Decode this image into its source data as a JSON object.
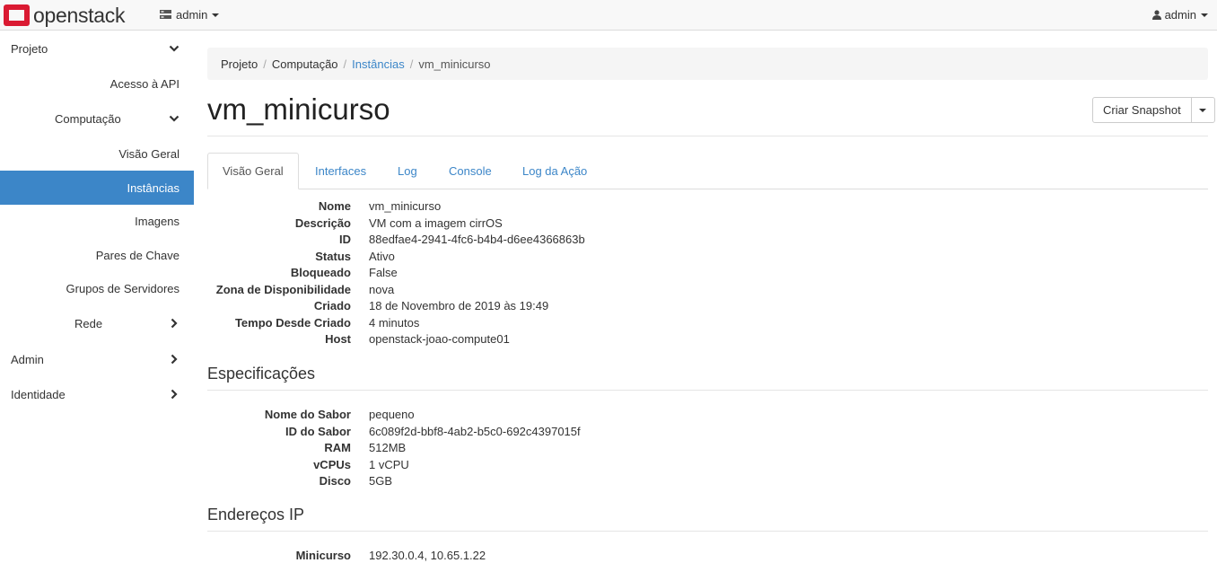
{
  "topbar": {
    "brand": "openstack",
    "project_selector": "admin",
    "user_menu": "admin"
  },
  "sidebar": {
    "items": [
      {
        "label": "Projeto",
        "level": 0,
        "chevron": "down"
      },
      {
        "label": "Acesso à API",
        "level": 1
      },
      {
        "label": "Computação",
        "level": 1,
        "chevron": "down"
      },
      {
        "label": "Visão Geral",
        "level": 2
      },
      {
        "label": "Instâncias",
        "level": 2,
        "active": true
      },
      {
        "label": "Imagens",
        "level": 2
      },
      {
        "label": "Pares de Chave",
        "level": 2
      },
      {
        "label": "Grupos de Servidores",
        "level": 2
      },
      {
        "label": "Rede",
        "level": 1,
        "chevron": "right"
      },
      {
        "label": "Admin",
        "level": 0,
        "chevron": "right"
      },
      {
        "label": "Identidade",
        "level": 0,
        "chevron": "right"
      }
    ]
  },
  "breadcrumb": {
    "items": [
      "Projeto",
      "Computação",
      "Instâncias",
      "vm_minicurso"
    ]
  },
  "page": {
    "title": "vm_minicurso",
    "snapshot_button": "Criar Snapshot"
  },
  "tabs": [
    "Visão Geral",
    "Interfaces",
    "Log",
    "Console",
    "Log da Ação"
  ],
  "overview": [
    {
      "k": "Nome",
      "v": "vm_minicurso"
    },
    {
      "k": "Descrição",
      "v": "VM com a imagem cirrOS"
    },
    {
      "k": "ID",
      "v": "88edfae4-2941-4fc6-b4b4-d6ee4366863b"
    },
    {
      "k": "Status",
      "v": "Ativo"
    },
    {
      "k": "Bloqueado",
      "v": "False"
    },
    {
      "k": "Zona de Disponibilidade",
      "v": "nova"
    },
    {
      "k": "Criado",
      "v": "18 de Novembro de 2019 às 19:49"
    },
    {
      "k": "Tempo Desde Criado",
      "v": "4 minutos"
    },
    {
      "k": "Host",
      "v": "openstack-joao-compute01"
    }
  ],
  "specs": {
    "heading": "Especificações",
    "rows": [
      {
        "k": "Nome do Sabor",
        "v": "pequeno"
      },
      {
        "k": "ID do Sabor",
        "v": "6c089f2d-bbf8-4ab2-b5c0-692c4397015f"
      },
      {
        "k": "RAM",
        "v": "512MB"
      },
      {
        "k": "vCPUs",
        "v": "1 vCPU"
      },
      {
        "k": "Disco",
        "v": "5GB"
      }
    ]
  },
  "ips": {
    "heading": "Endereços IP",
    "rows": [
      {
        "k": "Minicurso",
        "v": "192.30.0.4,  10.65.1.22"
      }
    ]
  },
  "colors": {
    "accent": "#3c86c8",
    "brand_red": "#da1a32"
  }
}
